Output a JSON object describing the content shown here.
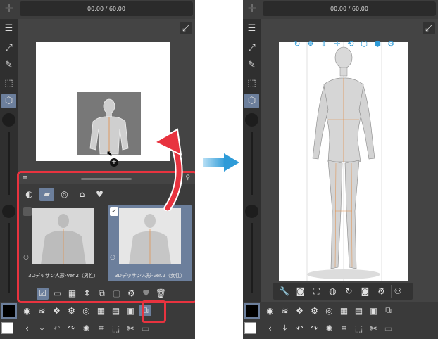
{
  "timer": "00:00 / 60:00",
  "colors": {
    "accent_selected": "#6c7f9c",
    "highlight": "#e8333f",
    "arrow_blue": "#2e9bd8",
    "ui_dark": "#3d3d3d"
  },
  "material_panel": {
    "tabs": [
      "clip-icon",
      "folder-icon",
      "search-icon",
      "tag-icon",
      "favorite-icon"
    ],
    "active_tab": 1,
    "items": [
      {
        "label": "3Dデッサン人形-Ver.2（男性）",
        "checked": false,
        "selected": false
      },
      {
        "label": "3Dデッサン人形-Ver.2（女性）",
        "checked": true,
        "selected": true
      }
    ]
  },
  "left_tools": [
    "menu-icon",
    "transform-icon",
    "pen-icon",
    "selection-icon",
    "object-icon"
  ],
  "right_toolbar_icons": [
    "settings-icon",
    "camera-icon",
    "fit-icon",
    "pose-icon",
    "rotate-icon",
    "snapshot-icon",
    "people-icon"
  ],
  "gizmo_icons": [
    "camera-rotate",
    "camera-pan",
    "camera-zoom",
    "object-move",
    "object-rotate",
    "object-scale",
    "object-reset"
  ]
}
